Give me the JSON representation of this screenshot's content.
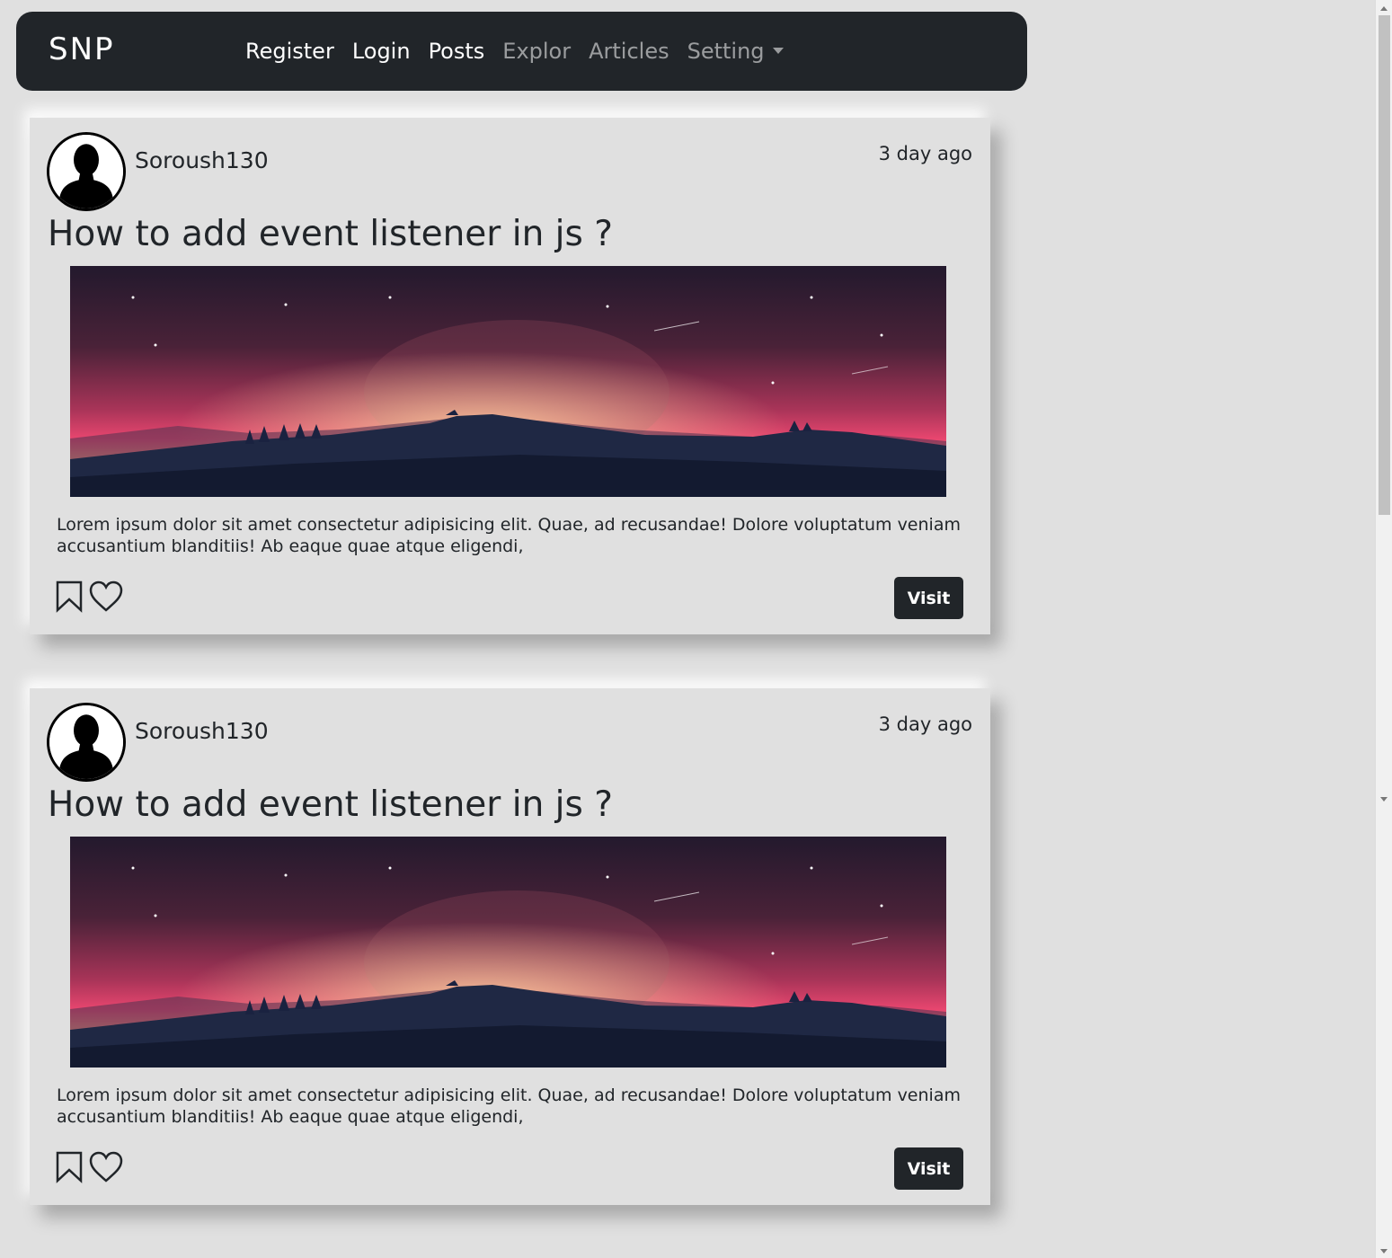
{
  "navbar": {
    "brand": "SNP",
    "links": [
      {
        "label": "Register",
        "active": true
      },
      {
        "label": "Login",
        "active": true
      },
      {
        "label": "Posts",
        "active": true
      },
      {
        "label": "Explor",
        "active": false
      },
      {
        "label": "Articles",
        "active": false
      },
      {
        "label": "Setting",
        "active": false,
        "dropdown": true
      }
    ]
  },
  "posts": [
    {
      "username": "Soroush130",
      "time": "3 day ago",
      "title": "How to add event listener in js ?",
      "excerpt": "Lorem ipsum dolor sit amet consectetur adipisicing elit. Quae, ad recusandae! Dolore voluptatum veniam accusantium blanditiis! Ab eaque quae atque eligendi,",
      "visit_label": "Visit"
    },
    {
      "username": "Soroush130",
      "time": "3 day ago",
      "title": "How to add event listener in js ?",
      "excerpt": "Lorem ipsum dolor sit amet consectetur adipisicing elit. Quae, ad recusandae! Dolore voluptatum veniam accusantium blanditiis! Ab eaque quae atque eligendi,",
      "visit_label": "Visit"
    }
  ],
  "icons": {
    "bookmark": "bookmark-icon",
    "like": "heart-icon",
    "avatar": "user-avatar-icon"
  },
  "colors": {
    "navbar_bg": "#212529",
    "page_bg": "#e0e0e0",
    "button_bg": "#212529"
  }
}
